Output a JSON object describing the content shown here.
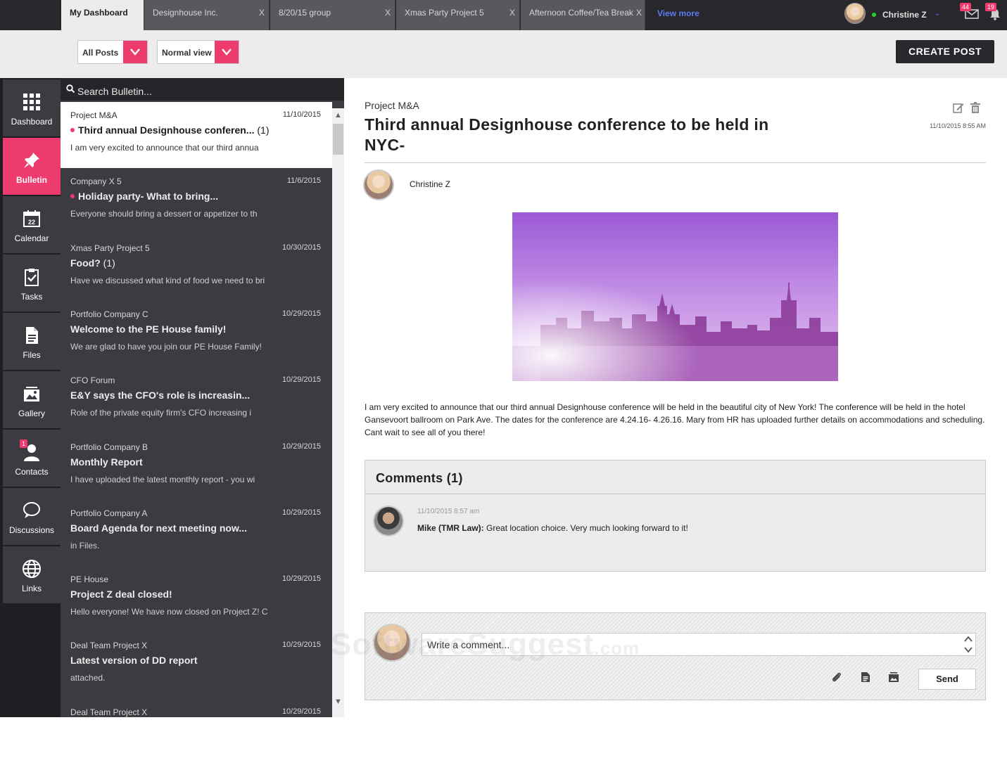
{
  "tabs": [
    {
      "label": "My Dashboard",
      "active": true,
      "closable": false
    },
    {
      "label": "Designhouse Inc.",
      "active": false,
      "closable": true
    },
    {
      "label": "8/20/15 group",
      "active": false,
      "closable": true
    },
    {
      "label": "Xmas Party Project 5",
      "active": false,
      "closable": true
    },
    {
      "label": "Afternoon Coffee/Tea Break",
      "active": false,
      "closable": true
    }
  ],
  "tab_close_glyph": "X",
  "view_more": "View more",
  "user": {
    "name": "Christine Z",
    "status": "online",
    "status_color": "#2fd12f"
  },
  "notifications": {
    "messages_count": "44",
    "alerts_count": "19",
    "messages_icon": "envelope-icon",
    "alerts_icon": "bell-icon"
  },
  "filters": {
    "posts_filter": "All Posts",
    "view_mode": "Normal view"
  },
  "create_post": "CREATE POST",
  "nav": [
    {
      "label": "Dashboard",
      "icon": "grid-icon",
      "active": false
    },
    {
      "label": "Bulletin",
      "icon": "pin-icon",
      "active": true
    },
    {
      "label": "Calendar",
      "icon": "calendar-icon",
      "active": false,
      "icon_text": "22"
    },
    {
      "label": "Tasks",
      "icon": "clipboard-check-icon",
      "active": false
    },
    {
      "label": "Files",
      "icon": "file-icon",
      "active": false
    },
    {
      "label": "Gallery",
      "icon": "gallery-icon",
      "active": false
    },
    {
      "label": "Contacts",
      "icon": "contact-icon",
      "active": false,
      "badge": "1"
    },
    {
      "label": "Discussions",
      "icon": "chat-icon",
      "active": false
    },
    {
      "label": "Links",
      "icon": "globe-icon",
      "active": false
    }
  ],
  "search": {
    "placeholder": "Search Bulletin..."
  },
  "posts": [
    {
      "group": "Project M&A",
      "date": "11/10/2015",
      "title": "Third annual Designhouse conferen...",
      "count": "(1)",
      "unread": true,
      "excerpt": "I am very excited to announce that our third annua",
      "active": true
    },
    {
      "group": "Company X 5",
      "date": "11/6/2015",
      "title": "Holiday party- What to bring...",
      "count": "",
      "unread": true,
      "excerpt": "Everyone should bring a dessert or appetizer to th"
    },
    {
      "group": "Xmas Party Project 5",
      "date": "10/30/2015",
      "title": "Food?",
      "count": "(1)",
      "unread": false,
      "excerpt": "Have we discussed what kind of food we need to bri"
    },
    {
      "group": "Portfolio Company C",
      "date": "10/29/2015",
      "title": "Welcome to the PE House family!",
      "count": "",
      "unread": false,
      "excerpt": "We are glad to have you join our PE House Family!"
    },
    {
      "group": "CFO Forum",
      "date": "10/29/2015",
      "title": "E&Y says the CFO's role is increasin...",
      "count": "",
      "unread": false,
      "excerpt": "Role of the private equity firm's CFO increasing i"
    },
    {
      "group": "Portfolio Company B",
      "date": "10/29/2015",
      "title": "Monthly Report",
      "count": "",
      "unread": false,
      "excerpt": "I have uploaded the latest monthly report - you wi"
    },
    {
      "group": "Portfolio Company A",
      "date": "10/29/2015",
      "title": "Board Agenda for next meeting now...",
      "count": "",
      "unread": false,
      "excerpt": "in Files."
    },
    {
      "group": "PE House",
      "date": "10/29/2015",
      "title": "Project Z deal closed!",
      "count": "",
      "unread": false,
      "excerpt": "Hello everyone! We have now closed on Project Z! C"
    },
    {
      "group": "Deal Team Project X",
      "date": "10/29/2015",
      "title": "Latest version of DD report",
      "count": "",
      "unread": false,
      "excerpt": "attached."
    },
    {
      "group": "Deal Team Project X",
      "date": "10/29/2015",
      "title": "",
      "count": "",
      "unread": false,
      "excerpt": ""
    }
  ],
  "detail": {
    "group": "Project M&A",
    "title": "Third annual Designhouse conference to be held in NYC-",
    "date": "11/10/2015 8:55 AM",
    "author": "Christine Z",
    "body": "I am very excited to announce that our third annual Designhouse conference will be held in the beautiful city of New York! The conference will be held in the hotel Gansevoort ballroom on Park Ave. The dates for the conference are 4.24.16- 4.26.16. Mary from HR has uploaded further details on accommodations and scheduling. Cant wait to see all of you there!"
  },
  "comments": {
    "title": "Comments (1)",
    "items": [
      {
        "date": "11/10/2015 8:57 am",
        "author": "Mike (TMR Law):",
        "text": "Great location choice. Very much looking forward to it!"
      }
    ]
  },
  "composer": {
    "placeholder": "Write a comment...",
    "send": "Send",
    "icons": [
      "paperclip-icon",
      "document-icon",
      "gallery-icon"
    ]
  },
  "watermark": {
    "text": "SoftwareSuggest",
    "suffix": ".com"
  },
  "colors": {
    "accent": "#ee3b6e",
    "dark": "#27272c",
    "panel": "#3b3b41",
    "link": "#5b7cf0"
  }
}
